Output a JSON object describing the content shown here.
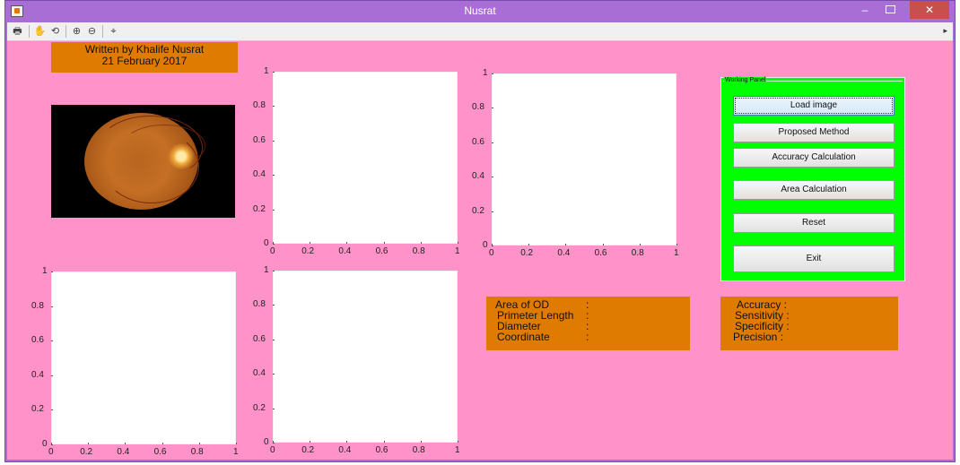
{
  "window": {
    "title": "Nusrat",
    "app_icon": "matlab-figure-icon"
  },
  "toolbar": {
    "tools": [
      "print-icon",
      "pan-icon",
      "rotate-3d-icon",
      "zoom-in-icon",
      "zoom-out-icon",
      "data-cursor-icon"
    ],
    "overflow_icon": "toolbar-overflow-icon"
  },
  "credit": {
    "line1": "Written by Khalife Nusrat",
    "line2": "21 February 2017"
  },
  "axes_ticks": {
    "y": [
      "1",
      "0.8",
      "0.6",
      "0.4",
      "0.2",
      "0"
    ],
    "x": [
      "0",
      "0.2",
      "0.4",
      "0.6",
      "0.8",
      "1"
    ]
  },
  "panel": {
    "title": "Working Panel",
    "buttons": {
      "load": "Load image",
      "proposed": "Proposed Method",
      "accuracy": "Accuracy Calculation",
      "area": "Area Calculation",
      "reset": "Reset",
      "exit": "Exit"
    }
  },
  "od_info": {
    "area": "Area  of OD",
    "perimeter": "Primeter Length",
    "diameter": "Diameter",
    "coordinate": "Coordinate",
    "sep": ":"
  },
  "metrics": {
    "accuracy": "Accuracy  :",
    "sensitivity": "Sensitivity :",
    "specificity": "Specificity :",
    "precision": "Precision   :"
  },
  "colors": {
    "figure_bg": "#ff92c8",
    "title_bar": "#a86ed6",
    "info_box": "#df7b00",
    "panel_bg": "#00ff00"
  }
}
